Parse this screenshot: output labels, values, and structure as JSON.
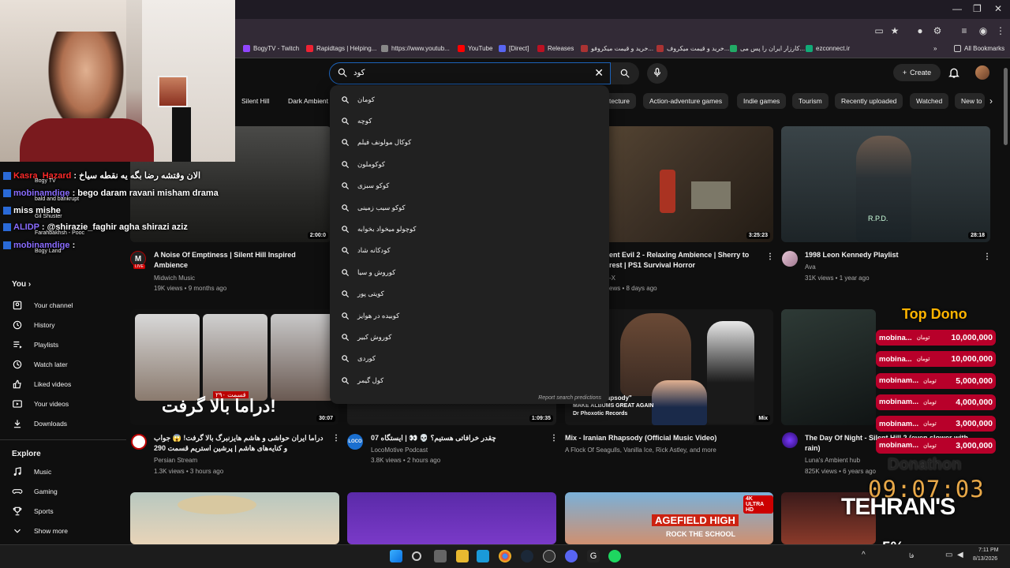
{
  "browser": {
    "bookmarks": [
      {
        "label": "BogyTV - Twitch",
        "color": "#9146ff"
      },
      {
        "label": "Rapidtags | Helping...",
        "color": "#e23"
      },
      {
        "label": "https://www.youtub...",
        "color": "#888"
      },
      {
        "label": "YouTube",
        "color": "#f00"
      },
      {
        "label": "[Direct]",
        "color": "#5865f2"
      },
      {
        "label": "Releases",
        "color": "#b12"
      },
      {
        "label": "خرید و قیمت میکروفو...",
        "color": "#a33"
      },
      {
        "label": "خرید و قیمت میکروف...",
        "color": "#a33"
      },
      {
        "label": "کارزار ایران را پس می...",
        "color": "#2a6"
      },
      {
        "label": "ezconnect.ir",
        "color": "#1a7"
      }
    ],
    "all_bookmarks": "All Bookmarks"
  },
  "header": {
    "search_query": "کود",
    "create_label": "Create"
  },
  "chips": [
    "Silent Hill",
    "Dark Ambient",
    "tecture",
    "Action-adventure games",
    "Indie games",
    "Tourism",
    "Recently uploaded",
    "Watched",
    "New to"
  ],
  "search_suggestions": [
    "کومان",
    "کوچه",
    "کوکال مولونف فیلم",
    "کوکوملون",
    "کوکو سبزی",
    "کوکو سیب زمینی",
    "کوچولو میخواد بخوابه",
    "کودکانه شاد",
    "کوروش و سیا",
    "کویتی پور",
    "کوبیده در هوایز",
    "کوروش کبیر",
    "کوردی",
    "کول گیمر"
  ],
  "report_link": "Report search predictions",
  "sidebar": {
    "you_label": "You",
    "items": [
      {
        "label": "Your channel",
        "icon": "channel-icon"
      },
      {
        "label": "History",
        "icon": "history-icon"
      },
      {
        "label": "Playlists",
        "icon": "playlist-icon"
      },
      {
        "label": "Watch later",
        "icon": "clock-icon"
      },
      {
        "label": "Liked videos",
        "icon": "thumbs-up-icon"
      },
      {
        "label": "Your videos",
        "icon": "play-icon"
      },
      {
        "label": "Downloads",
        "icon": "download-icon"
      }
    ],
    "explore_label": "Explore",
    "explore_items": [
      {
        "label": "Music",
        "icon": "music-icon"
      },
      {
        "label": "Gaming",
        "icon": "gaming-icon"
      },
      {
        "label": "Sports",
        "icon": "trophy-icon"
      },
      {
        "label": "Show more",
        "icon": "chevron-down-icon"
      }
    ]
  },
  "videos_row1": [
    {
      "title": "A Noise Of Emptiness | Silent Hill Inspired Ambience",
      "channel": "Midwich Music",
      "meta": "19K views • 9 months ago",
      "duration": "2:00:0",
      "live_badge": "LIVE"
    },
    {
      "title": "ent Evil 2 - Relaxing Ambience | Sherry to rest | PS1 Survival Horror",
      "channel": "-X",
      "meta": "ews • 8 days ago",
      "duration": "3:25:23"
    },
    {
      "title": "1998 Leon Kennedy Playlist",
      "channel": "Ava",
      "meta": "31K views • 1 year ago",
      "duration": "28:18"
    }
  ],
  "videos_row2": [
    {
      "title": "دراما ایران حواشی و هاشم هایزنبرگ بالا گرفت! 😱 جواب و کنایه‌های هاشم | پرشین استریم قسمت 290",
      "channel": "Persian Stream",
      "meta": "1.3K views • 3 hours ago",
      "duration": "30:07"
    },
    {
      "title": "چقدر خرافاتی هستیم؟ 💀 👀 | ایستگاه 07",
      "channel": "LocoMotive Podcast",
      "meta": "3.8K views • 2 hours ago",
      "duration": "1:09:35"
    },
    {
      "title": "Mix - Iranian Rhapsody (Official Music Video)",
      "channel": "A Flock Of Seagulls, Vanilla Ice, Rick Astley, and more",
      "meta": "",
      "duration": "Mix"
    },
    {
      "title": "The Day Of Night - Silent Hill 2 (even slower with rain)",
      "channel": "Luna's Ambient hub",
      "meta": "825K views • 6 years ago",
      "duration": ""
    }
  ],
  "thumb_texts": {
    "persian_stream": "دراما بالا گرفت!",
    "episode": "قسمت ۲۹۰",
    "rhapsody_line1": "\"Iranian Rhapsody\"",
    "rhapsody_line2": "MAKE ALBUMS GREAT AGAIN",
    "rhapsody_line3": "Dr Phoxotic Records",
    "agefield1": "AGEFIELD HIGH",
    "agefield2": "ROCK THE SCHOOL",
    "uhd": "4K ULTRA HD",
    "rpd": "R.P.D."
  },
  "stream_overlay": {
    "chat": [
      {
        "badge": "1",
        "user": "Kasra_Hazard",
        "user_color": "#ff2a2a",
        "text": " : الان وقتشه رضا بگه یه نقطه سیاخ",
        "sub": "Bogy TV"
      },
      {
        "badge": "",
        "user": "mobinamdige",
        "user_color": "#8a6cff",
        "text": " : bego daram ravani misham drama",
        "sub": "bald and bankrupt"
      },
      {
        "badge": "",
        "user": "",
        "user_color": "#fff",
        "text": "miss mishe",
        "sub": "Gil Shuster"
      },
      {
        "badge": "",
        "user": "ALIDP",
        "user_color": "#8a6cff",
        "text": " : @shirazie_faghir agha shirazi aziz",
        "sub": "Farahbakhsh - Pooc"
      },
      {
        "badge": "",
        "user": "mobinamdige",
        "user_color": "#8a6cff",
        "text": " :",
        "sub": "Bogy Land"
      }
    ],
    "top_dono_title": "Top Dono",
    "donations": [
      {
        "name": "mobina...",
        "currency": "تومان",
        "amount": "10,000,000"
      },
      {
        "name": "mobina...",
        "currency": "تومان",
        "amount": "10,000,000"
      },
      {
        "name": "mobinam...",
        "currency": "تومان",
        "amount": "5,000,000"
      },
      {
        "name": "mobinam...",
        "currency": "تومان",
        "amount": "4,000,000"
      },
      {
        "name": "mobinam...",
        "currency": "تومان",
        "amount": "3,000,000"
      },
      {
        "name": "mobinam...",
        "currency": "تومان",
        "amount": "3,000,000"
      }
    ],
    "donathon": "Donathon",
    "timer": "09:07:03",
    "tehrans": "TEHRAN'S",
    "percent": "5%"
  },
  "taskbar": {
    "time": "7:11 PM",
    "date": "8/13/2026",
    "lang": "فا"
  },
  "colors": {
    "accent": "#1c62b9",
    "donation_red": "#b8002a",
    "dono_gold": "#ffb400"
  }
}
